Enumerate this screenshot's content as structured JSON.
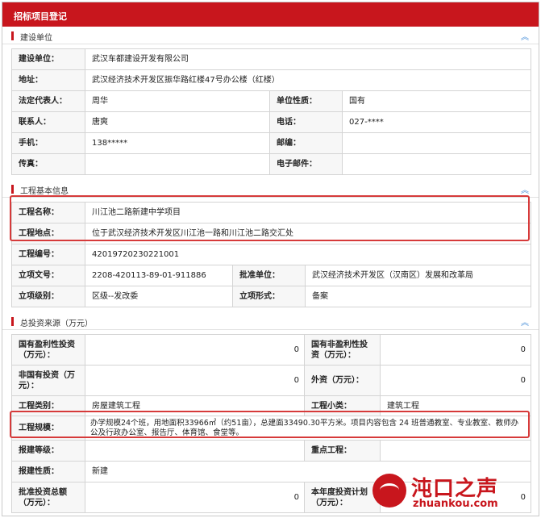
{
  "window_title": "招标项目登记",
  "sections": {
    "builder": {
      "title": "建设单位",
      "rows": {
        "unit_label": "建设单位：",
        "unit_value": "武汉车都建设开发有限公司",
        "addr_label": "地址：",
        "addr_value": "武汉经济技术开发区振华路红楼47号办公楼（红楼）",
        "rep_label": "法定代表人：",
        "rep_value": "周华",
        "nature_label": "单位性质：",
        "nature_value": "国有",
        "contact_label": "联系人：",
        "contact_value": "唐爽",
        "phone_label": "电话：",
        "phone_value": "027-****",
        "mobile_label": "手机：",
        "mobile_value": "138*****",
        "postcode_label": "邮编：",
        "postcode_value": "",
        "fax_label": "传真：",
        "fax_value": "",
        "email_label": "电子邮件：",
        "email_value": ""
      }
    },
    "project": {
      "title": "工程基本信息",
      "rows": {
        "name_label": "工程名称：",
        "name_value": "川江池二路新建中学项目",
        "site_label": "工程地点：",
        "site_value": "位于武汉经济技术开发区川江池一路和川江池二路交汇处",
        "code_label": "工程编号：",
        "code_value": "42019720230221001",
        "doc_label": "立项文号：",
        "doc_value": "2208-420113-89-01-911886",
        "approver_label": "批准单位：",
        "approver_value": "武汉经济技术开发区（汉南区）发展和改革局",
        "level_label": "立项级别：",
        "level_value": "区级--发改委",
        "form_label": "立项形式：",
        "form_value": "备案"
      }
    },
    "investment": {
      "title": "总投资来源（万元）",
      "rows": {
        "state_profit_label": "国有盈利性投资（万元）：",
        "state_profit_value": "0",
        "state_nonprofit_label": "国有非盈利性投资（万元）：",
        "state_nonprofit_value": "0",
        "nonstate_label": "非国有投资（万元）：",
        "nonstate_value": "0",
        "foreign_label": "外资（万元）：",
        "foreign_value": "0",
        "category_label": "工程类别：",
        "category_value": "房屋建筑工程",
        "subcategory_label": "工程小类：",
        "subcategory_value": "建筑工程",
        "scale_label": "工程规模：",
        "scale_value": "办学规模24个班，用地面积33966㎡（约51亩），总建面33490.30平方米。项目内容包含 24 班普通教室、专业教室、教师办公及行政办公室、报告厅、体育馆、食堂等。",
        "report_level_label": "报建等级：",
        "report_level_value": "",
        "key_project_label": "重点工程：",
        "key_project_value": "",
        "report_nature_label": "报建性质：",
        "report_nature_value": "新建",
        "approved_total_label": "批准投资总额（万元）：",
        "approved_total_value": "0",
        "year_plan_label": "本年度投资计划（万元）：",
        "year_plan_value": "0"
      }
    }
  },
  "watermark": {
    "brand": "沌口之声",
    "url": "zhuankou.com"
  },
  "colors": {
    "accent": "#c8161d",
    "highlight": "#d63a3a",
    "collapse_icon": "#4a90d9"
  }
}
